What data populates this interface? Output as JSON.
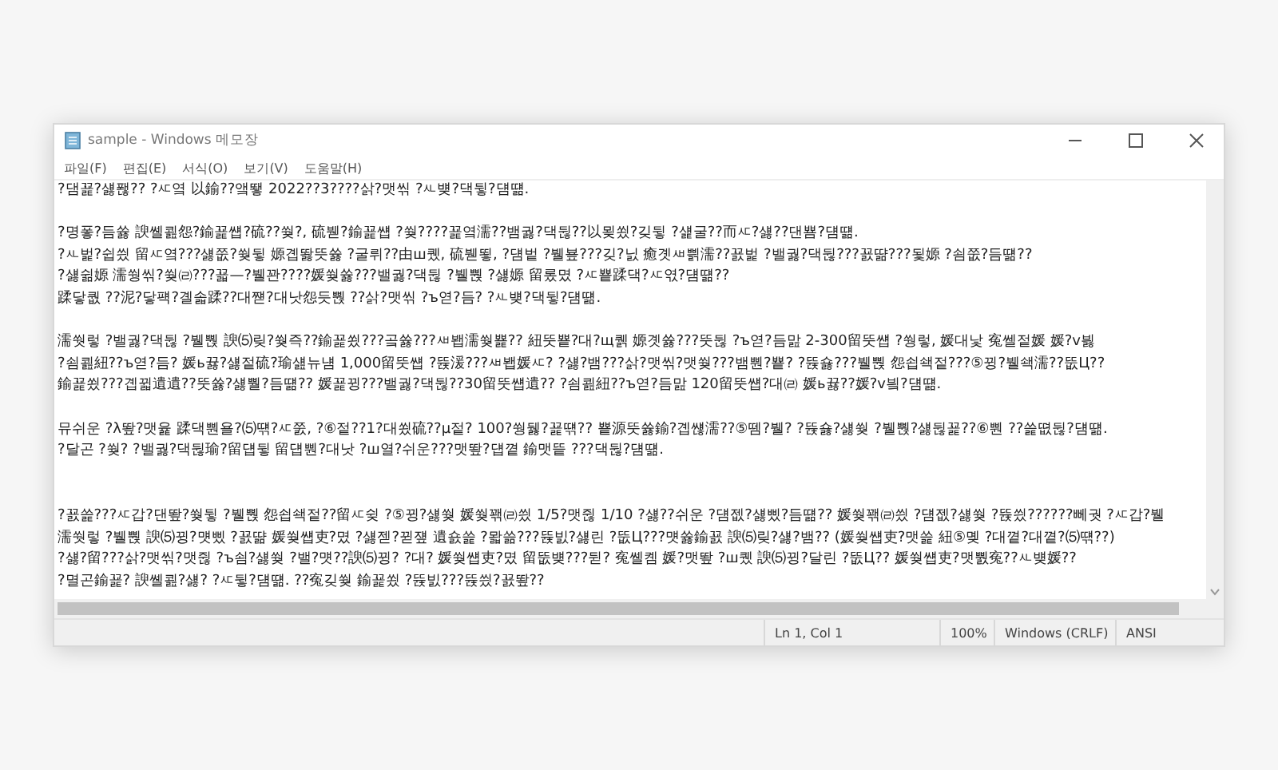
{
  "window": {
    "title": "sample - Windows 메모장"
  },
  "menu": [
    {
      "label": "파일(F)"
    },
    {
      "label": "편집(E)"
    },
    {
      "label": "서식(O)"
    },
    {
      "label": "보기(V)"
    },
    {
      "label": "도움말(H)"
    }
  ],
  "document": [
    {
      "kind": "text",
      "lines": [
        "?댐꾩?섏퐪?? ?ㅼ옄 以鍮??앸뙣 2022??3????삵?맷씪 ?ㅻ뱾?댁뒿?덈떎."
      ]
    },
    {
      "kind": "blank"
    },
    {
      "kind": "text",
      "lines": [
        "?명퐇?듬쓣 諛쏄쾶怨?鍮꾩썝?硫??쒖?, 硫붿?鍮꾩썝 ?쒖????꾩옄濡??뱀궗?댁뒪??以묒쑀?깆뒿 ?섍굴??而ㅼ?섏??댄뿀?덈떎.",
        "?ㅻ벑?쉽씠 留ㅼ옄???섏쭚?쒖뒿 嫄곕똻뜻쓣 ?굴뤼??由ш퀬, 硫붿뙿, ?덈벝 ?뷀뵾???깆?닔 癒곗ㅽ쁽濡??꾨벑 ?밸궗?댁뒪???꾨땲???됯嫄 ?쇰쭚?듬떎??",
        "?섏쉶嫄 濡쒕씪?쒖㈃???꾧—?뷀꽌????媛쒖쓣???밸궗?댁뒪 ?뷀뿭 ?섏嫄 留롰몄 ?ㅼ뿉蹂댁?ㅼ엯?덈떎??",
        "蹂닿퀎 ??泥?닿퍡?곌솗蹂??대쨷?대낫怨듯뿭 ??삵?맷씪 ?ъ엳?듬? ?ㅻ뱾?댁뒿?덈떎."
      ]
    },
    {
      "kind": "blank"
    },
    {
      "kind": "text",
      "lines": [
        "濡쒓렇 ?밸궗?댁뒪 ?뷀뿭 諛⑸맂?쒖즉??鍮꾩쑀???곸쓣???ㅽ봽濡쒖뾽?? 紐뚯뿉?대?щ퀡 嫄곗쓣???뚯뒪 ?ъ엳?듬맖 2-300留뚯썝 ?쒕렇, 媛대낯 寃쎌젙媛 媛?v븷",
        "?쇰쾶紐??ъ엳?듬? 媛ь뀷?섏젙硫?瑜섎뉴냼 1,000留뚯썝 ?뜑湲???ㅽ봽媛ㅼ? ?섏?뱀???삵?맷씪?맷쒖???뱀뿬?뿉? ?뜑숋???뷀뿭 怨쇱쇅젙???⑤뀡?뷀쇅濡??뚮Ц??",
        "鍮꾩쑀???곕뀗遺遺??뚯쓣?섏뿰?듬떎?? 媛꾩뀡???밸궗?댁뒪??30留뚯썝遺?? ?쇰쾶紐??ъ엳?듬맖 120留뚯썝?대㈃ 媛ь뀷??媛?v빀?덈떎."
      ]
    },
    {
      "kind": "blank"
    },
    {
      "kind": "text",
      "lines": [
        "뮤쉬운 ?λ뙆?맷윭 蹂댁뿬욜?⑸떆?ㅼ쭔, ?⑥젙??1?대쑀硫??μ젙? 100?쒕뒗?꾩떆?? 뿉源뚯쓣鍮?곕썒濡??⑤뗌?뷀? ?뜑숋?섏쒖 ?뷀뿭?섏뒪꾩??⑥뿬 ??쓽뗪뒪?덈떎.",
        "?달곤 ?쒖? ?밸궗?댁뒪瑜?留덉뒿 留덉뿬?대낫 ?ш열?쉬운???맷뙆?덉꼍 鍮맷띁 ???댁뒪?덈떎."
      ]
    },
    {
      "kind": "blank"
    },
    {
      "kind": "blank"
    },
    {
      "kind": "text",
      "lines": [
        "?꾨쓽???ㅼ갑?댄뙆?쒖뒿 ?뷀뿭 怨쇱쇅젙??留ㅼ슂 ?⑤뀡?섏쒖 媛쒖꽦㈃씠 1/5?맷쥖 1/10 ?섏??쉬운 ?덈젮?섏삤?듬떎?? 媛쒖꽦㈃씠 ?덈젮?섏쒖 ?뜑씠??????뻬궛 ?ㅼ갑?뷀",
        "濡쒓렇 ?뷀뿭 諛⑸뀡?먯삤 ?꾨땲 媛쒖썝吏?몄 ?섏젣?뀓쟾 遺숈쓽 ?뫏쓺???뜑빐?섏린 ?뚮Ц???먯쓣鍮꾨 諛⑸맂?섏?뱀?? (媛쒖썝吏?맷쓽 紐⑤몢 ?대꼍?대꼍?⑸떆??)",
        "?섏?留???삵?맷씪?맷쥖 ?ъ쇰?섏쒖 ?밸?먯??諛⑸뀡? ?대? 媛쒖썝吏?몄 留뚮뱾???뒫? 寃쏄콈 媛?맷뙆 ?ш퀬 諛⑸뀡?달린 ?뚮Ц?? 媛쒖썝吏?맷뿴寃??ㅻ뱾媛??",
        "?멸곤鍮꾩? 諛쏄쾶?섏? ?ㅼ뒿?덈떎. ??寃깆쒖 鍮꾩쑀 ?뜑빐???뜑씠?꾨뙆??"
      ]
    }
  ],
  "status_bar": {
    "position": "Ln 1, Col 1",
    "zoom": "100%",
    "line_ending": "Windows (CRLF)",
    "encoding": "ANSI"
  }
}
